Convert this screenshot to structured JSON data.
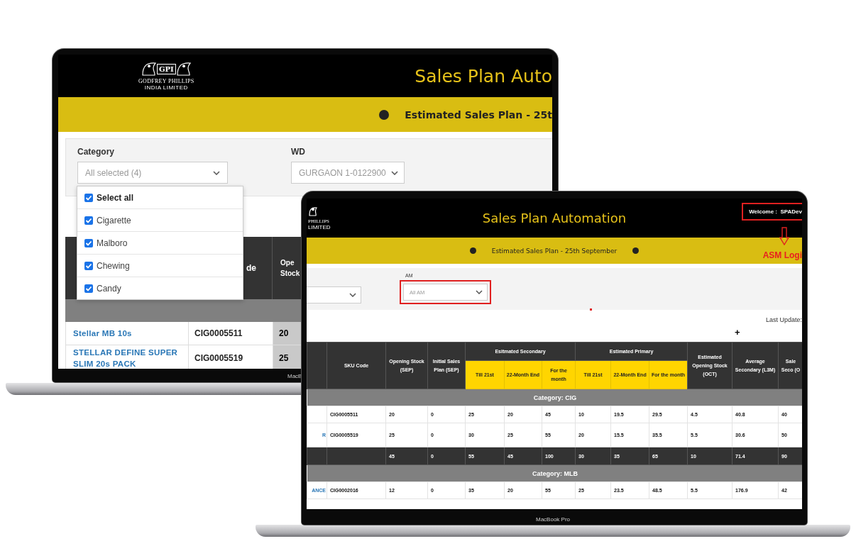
{
  "back_laptop": {
    "bezel_label": "MacB",
    "header": {
      "logo": {
        "mark": "GPI",
        "name": "GODFREY PHILLIPS",
        "sub": "INDIA LIMITED"
      },
      "title": "Sales Plan Auto"
    },
    "banner": {
      "text": "Estimated Sales Plan - 25t"
    },
    "filters": [
      {
        "label": "Category",
        "value": "All selected (4)"
      },
      {
        "label": "WD",
        "value": "GURGAON 1-0122900"
      }
    ],
    "dropdown": {
      "options": [
        {
          "label": "Select all",
          "checked": true,
          "kind": "all"
        },
        {
          "label": "Cigarette",
          "checked": true,
          "kind": "option"
        },
        {
          "label": "Malboro",
          "checked": true,
          "kind": "option"
        },
        {
          "label": "Chewing",
          "checked": true,
          "kind": "option"
        },
        {
          "label": "Candy",
          "checked": true,
          "kind": "option"
        }
      ]
    },
    "table": {
      "header_cells": [
        "de",
        "Ope\nStock"
      ],
      "rows": [
        {
          "name": "Stellar MB 10s",
          "sku": "CIG0005511",
          "opening": "20"
        },
        {
          "name": "STELLAR DEFINE SUPER SLIM 20s PACK",
          "sku": "CIG0005519",
          "opening": "25"
        }
      ]
    }
  },
  "front_laptop": {
    "bezel_label": "MacBook Pro",
    "header": {
      "logo": {
        "name": "PHILLIPS",
        "sub": "LIMITED"
      },
      "title": "Sales Plan Automation",
      "welcome": "Welcome :  SPADev",
      "highlighted": true
    },
    "annotation": {
      "text": "ASM Logi"
    },
    "banner": {
      "text": "Estimated Sales Plan - 25th September"
    },
    "filter": {
      "label": "AM",
      "value": "All AM",
      "highlighted": true
    },
    "last_update": "Last Update:",
    "add_label": "+",
    "table": {
      "columns": [
        "SKU Code",
        "Opening Stock (SEP)",
        "Initial Sales Plan (SEP)"
      ],
      "groups": [
        {
          "title": "Esitmated Secondary",
          "columns": [
            "Till 21st",
            "22-Month End",
            "For the month"
          ]
        },
        {
          "title": "Estimated Primary",
          "columns": [
            "Till 21st",
            "22-Month End",
            "For the month"
          ]
        }
      ],
      "tail_columns": [
        "Estimated Opening Stock (OCT)",
        "Average Secondary (L3M)",
        "Sale Seco (O"
      ],
      "rows": [
        {
          "kind": "category",
          "text": "Category: CIG"
        },
        {
          "kind": "item",
          "sku": "CIG0005511",
          "values": [
            "20",
            "0",
            "25",
            "20",
            "45",
            "10",
            "19.5",
            "29.5",
            "4.5",
            "40.8",
            "40"
          ]
        },
        {
          "kind": "item",
          "name": "R",
          "sku": "CIG0005519",
          "values": [
            "25",
            "0",
            "30",
            "25",
            "55",
            "20",
            "15.5",
            "35.5",
            "5.5",
            "30.6",
            "50"
          ]
        },
        {
          "kind": "total",
          "values": [
            "45",
            "0",
            "55",
            "45",
            "100",
            "30",
            "35",
            "65",
            "10",
            "71.4",
            "90"
          ]
        },
        {
          "kind": "category",
          "text": "Category: MLB"
        },
        {
          "kind": "item",
          "name": "ANCE",
          "sku": "CIG0002016",
          "values": [
            "12",
            "0",
            "35",
            "20",
            "55",
            "25",
            "23.5",
            "48.5",
            "5.5",
            "176.9",
            "42"
          ]
        }
      ]
    }
  }
}
